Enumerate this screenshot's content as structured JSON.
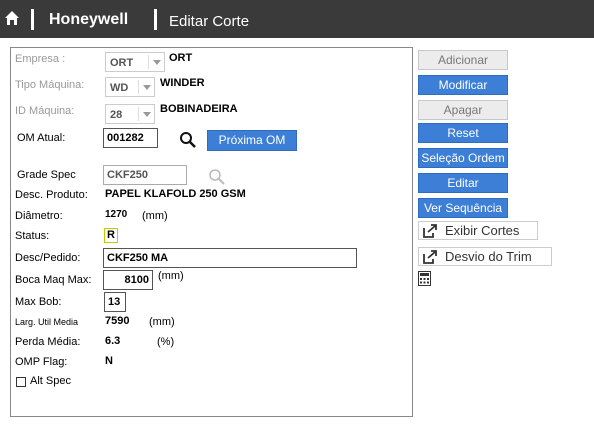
{
  "header": {
    "brand": "Honeywell",
    "title": "Editar Corte"
  },
  "form": {
    "empresa": {
      "label": "Empresa :",
      "select_value": "ORT",
      "text": "ORT"
    },
    "tipo_maquina": {
      "label": "Tipo Máquina:",
      "select_value": "WD",
      "text": "WINDER"
    },
    "id_maquina": {
      "label": "ID Máquina:",
      "select_value": "28",
      "text": "BOBINADEIRA"
    },
    "om_atual": {
      "label": "OM Atual:",
      "value": "001282",
      "next_button": "Próxima OM"
    },
    "grade_spec": {
      "label": "Grade Spec",
      "value": "CKF250"
    },
    "desc_produto": {
      "label": "Desc. Produto:",
      "value": "PAPEL KLAFOLD 250 GSM"
    },
    "diametro": {
      "label": "Diâmetro:",
      "value": "1270",
      "unit": "(mm)"
    },
    "status": {
      "label": "Status:",
      "value": "R"
    },
    "desc_pedido": {
      "label": "Desc/Pedido:",
      "value": "CKF250 MA"
    },
    "boca_maq_max": {
      "label": "Boca Maq Max:",
      "value": "8100",
      "unit": "(mm)"
    },
    "max_bob": {
      "label": "Max Bob:",
      "value": "13"
    },
    "larg_util_media": {
      "label": "Larg. Util Media",
      "value": "7590",
      "unit": "(mm)"
    },
    "perda_media": {
      "label": "Perda Média:",
      "value": "6.3",
      "unit": "(%)"
    },
    "omp_flag": {
      "label": "OMP Flag:",
      "value": "N"
    },
    "alt_spec": {
      "label": "Alt Spec"
    }
  },
  "actions": {
    "adicionar": "Adicionar",
    "modificar": "Modificar",
    "apagar": "Apagar",
    "reset": "Reset",
    "selecao_ordem": "Seleção Ordem",
    "editar": "Editar",
    "ver_sequencia": "Ver Sequência",
    "exibir_cortes": "Exibir Cortes",
    "desvio_do_trim": "Desvio do Trim"
  },
  "colors": {
    "header_bg": "#3a3a3a",
    "primary_button": "#3d7fd6",
    "disabled_button": "#ececec"
  }
}
